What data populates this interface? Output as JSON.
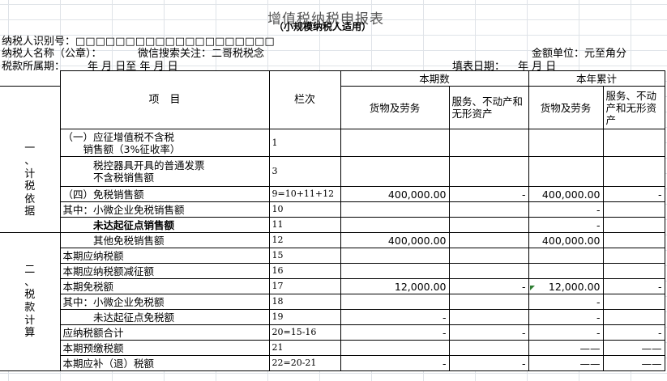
{
  "title": "增值税纳税申报表",
  "subtitle": "（小规模纳税人适用）",
  "header": {
    "taxpayer_id_label": "纳税人识别号：",
    "taxpayer_id_boxes": "□□□□□□□□□□□□□□□□□□□□",
    "taxpayer_name_label": "纳税人名称（公章）：",
    "wechat_note": "微信搜索关注：二哥税税念",
    "amount_unit": "金额单位：元至角分",
    "period_label": "税款所属期：",
    "period_value": "年  月  日至    年  月  日",
    "fill_date_label": "填表日期：",
    "fill_date_value": "年  月  日"
  },
  "table": {
    "section1": "一、计税依据",
    "section2": "二、税款计算",
    "col_item": "项　目",
    "col_no": "栏次",
    "this_period": "本期数",
    "ytd": "本年累计",
    "goods_services": "货物及劳务",
    "services_assets": "服务、不动产和无形资产",
    "rows": [
      {
        "item": "（一）应征增值税不含税\n　　销售额（3%征收率）",
        "no": "1",
        "a": "",
        "b": "",
        "c": "",
        "d": ""
      },
      {
        "item": "　　　税控器具开具的普通发票\n　　　不含税销售额",
        "no": "3",
        "a": "",
        "b": "",
        "c": "",
        "d": ""
      },
      {
        "item": "（四）免税销售额",
        "no": "9=10+11+12",
        "a": "400,000.00",
        "b": "-",
        "c": "400,000.00",
        "d": "-"
      },
      {
        "item": "其中：小微企业免税销售额",
        "no": "10",
        "a": "",
        "b": "",
        "c": "-",
        "d": ""
      },
      {
        "item": "　　　未达起征点销售额",
        "no": "11",
        "a": "",
        "b": "",
        "c": "-",
        "d": ""
      },
      {
        "item": "　　　其他免税销售额",
        "no": "12",
        "a": "400,000.00",
        "b": "",
        "c": "400,000.00",
        "d": ""
      },
      {
        "item": "本期应纳税额",
        "no": "15",
        "a": "",
        "b": "",
        "c": "",
        "d": ""
      },
      {
        "item": "本期应纳税额减征额",
        "no": "16",
        "a": "",
        "b": "",
        "c": "",
        "d": ""
      },
      {
        "item": "本期免税额",
        "no": "17",
        "a": "12,000.00",
        "b": "-",
        "c": "12,000.00",
        "d": "-"
      },
      {
        "item": "其中：小微企业免税额",
        "no": "18",
        "a": "",
        "b": "",
        "c": "-",
        "d": ""
      },
      {
        "item": "　　　未达起征点免税额",
        "no": "19",
        "a": "-",
        "b": "",
        "c": "-",
        "d": ""
      },
      {
        "item": "应纳税额合计",
        "no": "20=15-16",
        "a": "-",
        "b": "-",
        "c": "-",
        "d": "-"
      },
      {
        "item": "本期预缴税额",
        "no": "21",
        "a": "",
        "b": "",
        "c": "——",
        "d": "——"
      },
      {
        "item": "本期应补（退）税额",
        "no": "22=20-21",
        "a": "-",
        "b": "-",
        "c": "——",
        "d": "——"
      }
    ]
  }
}
